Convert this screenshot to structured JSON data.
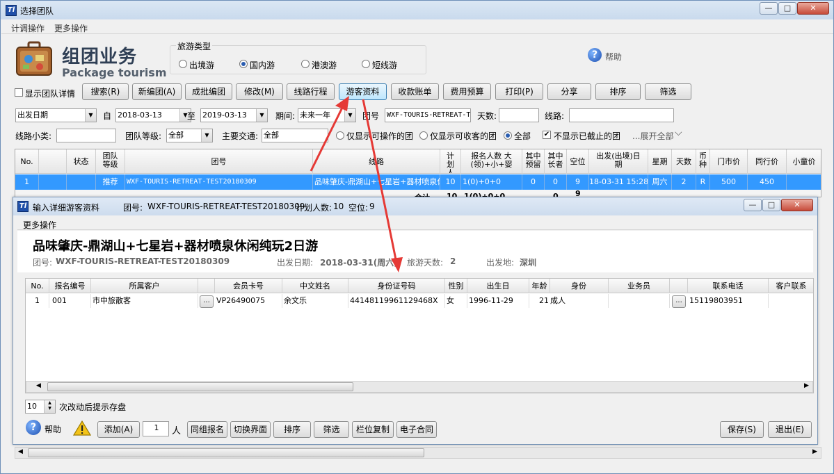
{
  "window": {
    "title": "选择团队",
    "icon_letters": "Tl"
  },
  "menubar": [
    "计调操作",
    "更多操作"
  ],
  "header": {
    "title_cn": "组团业务",
    "title_en": "Package tourism",
    "help_label": "帮助"
  },
  "tour_type": {
    "legend": "旅游类型",
    "options": [
      "出境游",
      "国内游",
      "港澳游",
      "短线游"
    ],
    "selected": "国内游"
  },
  "toolbar": {
    "show_detail_label": "显示团队详情",
    "buttons": [
      "搜索(R)",
      "新编团(A)",
      "成批编团",
      "修改(M)",
      "线路行程",
      "游客资料",
      "收款账单",
      "费用预算",
      "打印(P)",
      "分享",
      "排序",
      "筛选"
    ]
  },
  "filters": {
    "date_type": "出发日期",
    "from_label": "自",
    "from_date": "2018-03-13",
    "to_label": "至",
    "to_date": "2019-03-13",
    "period_label": "期间:",
    "period": "未来一年",
    "team_no_label": "团号",
    "team_no": "WXF-TOURIS-RETREAT-T",
    "days_label": "天数:",
    "days": "",
    "route_label": "线路:",
    "route": "",
    "route_sub_label": "线路小类:",
    "route_sub": "",
    "team_level_label": "团队等级:",
    "team_level": "全部",
    "transport_label": "主要交通:",
    "transport": "全部",
    "opt_operable": "仅显示可操作的团",
    "opt_collectable": "仅显示可收客的团",
    "opt_all": "全部",
    "opt_hide_closed": "不显示已截止的团",
    "expand_all": "...展开全部"
  },
  "main_grid": {
    "columns": [
      "No.",
      "",
      "状态",
      "团队等级",
      "团号",
      "线路",
      "计划人数",
      "报名人数 大(领)+小+婴",
      "其中预留",
      "其中长者",
      "空位",
      "出发(出境)日期",
      "星期",
      "天数",
      "币种",
      "门市价",
      "同行价",
      "小童价"
    ],
    "rows": [
      [
        "1",
        "",
        "",
        "推荐",
        "WXF-TOURIS-RETREAT-TEST20180309",
        "品味肇庆-鼎湖山+七星岩+器材喷泉休闲纯玩2日游",
        "10",
        "1(0)+0+0",
        "0",
        "0",
        "9",
        "18-03-31 15:28",
        "周六",
        "2",
        "R",
        "500",
        "450",
        ""
      ]
    ],
    "summary_row": {
      "label": "合计",
      "plan": "10",
      "signup": "1(0)+0+0",
      "reserved": "0",
      "vacant": "9"
    }
  },
  "subwindow": {
    "title": "输入详细游客资料",
    "team_no_label": "团号:",
    "team_no": "WXF-TOURIS-RETREAT-TEST20180309",
    "plan_label": "计划人数:",
    "plan": "10",
    "vacant_label": "空位:",
    "vacant": "9",
    "menu": "更多操作",
    "route_title": "品味肇庆-鼎湖山+七星岩+器材喷泉休闲纯玩2日游",
    "info": {
      "team_label": "团号:",
      "team": "WXF-TOURIS-RETREAT-TEST20180309",
      "depart_label": "出发日期:",
      "depart": "2018-03-31(周六)",
      "days_label": "旅游天数:",
      "days": "2",
      "origin_label": "出发地:",
      "origin": "深圳"
    },
    "columns": [
      "No.",
      "报名编号",
      "所属客户",
      "",
      "会员卡号",
      "中文姓名",
      "身份证号码",
      "性别",
      "出生日",
      "年龄",
      "身份",
      "业务员",
      "",
      "联系电话",
      "客户联系"
    ],
    "rows": [
      [
        "1",
        "001",
        "市中旅散客",
        "...",
        "VP26490075",
        "余文乐",
        "44148119961129468X",
        "女",
        "1996-11-29",
        "21",
        "成人",
        "",
        "...",
        "15119803951",
        ""
      ]
    ],
    "autosave_count": "10",
    "autosave_label": "次改动后提示存盘",
    "help_label": "帮助",
    "add_button": "添加(A)",
    "add_count": "1",
    "person_unit": "人",
    "buttons": [
      "同组报名",
      "切换界面",
      "排序",
      "筛选",
      "栏位复制",
      "电子合同"
    ],
    "save_button": "保存(S)",
    "exit_button": "退出(E)"
  },
  "colors": {
    "selection": "#3399ff",
    "arrow": "#e53935",
    "title_gradient": "#cddcee"
  }
}
